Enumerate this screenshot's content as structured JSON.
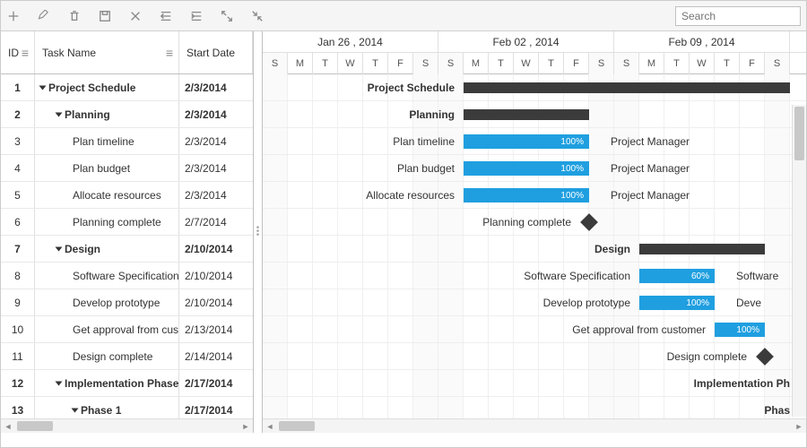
{
  "toolbar": {
    "search_placeholder": "Search",
    "icons": [
      "plus",
      "edit",
      "trash",
      "save",
      "cancel",
      "outdent",
      "indent",
      "expand",
      "collapse"
    ]
  },
  "grid": {
    "headers": {
      "id": "ID",
      "task": "Task Name",
      "date": "Start Date"
    },
    "rows": [
      {
        "id": "1",
        "name": "Project Schedule",
        "date": "2/3/2014",
        "indent": 0,
        "bold": true,
        "expander": true
      },
      {
        "id": "2",
        "name": "Planning",
        "date": "2/3/2014",
        "indent": 1,
        "bold": true,
        "expander": true
      },
      {
        "id": "3",
        "name": "Plan timeline",
        "date": "2/3/2014",
        "indent": 2
      },
      {
        "id": "4",
        "name": "Plan budget",
        "date": "2/3/2014",
        "indent": 2
      },
      {
        "id": "5",
        "name": "Allocate resources",
        "date": "2/3/2014",
        "indent": 2
      },
      {
        "id": "6",
        "name": "Planning complete",
        "date": "2/7/2014",
        "indent": 2
      },
      {
        "id": "7",
        "name": "Design",
        "date": "2/10/2014",
        "indent": 1,
        "bold": true,
        "expander": true
      },
      {
        "id": "8",
        "name": "Software Specification",
        "date": "2/10/2014",
        "indent": 2
      },
      {
        "id": "9",
        "name": "Develop prototype",
        "date": "2/10/2014",
        "indent": 2
      },
      {
        "id": "10",
        "name": "Get approval from customer",
        "date": "2/13/2014",
        "indent": 2
      },
      {
        "id": "11",
        "name": "Design complete",
        "date": "2/14/2014",
        "indent": 2
      },
      {
        "id": "12",
        "name": "Implementation Phase",
        "date": "2/17/2014",
        "indent": 1,
        "bold": true,
        "expander": true
      },
      {
        "id": "13",
        "name": "Phase 1",
        "date": "2/17/2014",
        "indent": 2,
        "bold": true,
        "expander": true
      }
    ]
  },
  "timeline": {
    "day_width": 28,
    "start_day_index": 0,
    "weeks": [
      {
        "label": "Jan 26 , 2014",
        "days": 7
      },
      {
        "label": "Feb 02 , 2014",
        "days": 7
      },
      {
        "label": "Feb 09 , 2014",
        "days": 7
      }
    ],
    "day_letters": [
      "S",
      "M",
      "T",
      "W",
      "T",
      "F",
      "S"
    ],
    "rows": [
      {
        "type": "summary",
        "label": "Project Schedule",
        "label_side": "left",
        "start": 8,
        "end": 21
      },
      {
        "type": "summary",
        "label": "Planning",
        "label_side": "left",
        "start": 8,
        "end": 13
      },
      {
        "type": "task",
        "label": "Plan timeline",
        "label_side": "left",
        "start": 8,
        "end": 13,
        "progress": 100,
        "resource": "Project Manager"
      },
      {
        "type": "task",
        "label": "Plan budget",
        "label_side": "left",
        "start": 8,
        "end": 13,
        "progress": 100,
        "resource": "Project Manager"
      },
      {
        "type": "task",
        "label": "Allocate resources",
        "label_side": "left",
        "start": 8,
        "end": 13,
        "progress": 100,
        "resource": "Project Manager"
      },
      {
        "type": "milestone",
        "label": "Planning complete",
        "label_side": "left",
        "start": 13
      },
      {
        "type": "summary",
        "label": "Design",
        "label_side": "left",
        "start": 15,
        "end": 20
      },
      {
        "type": "task",
        "label": "Software Specification",
        "label_side": "left",
        "start": 15,
        "end": 18,
        "progress": 60,
        "resource": "Software"
      },
      {
        "type": "task",
        "label": "Develop prototype",
        "label_side": "left",
        "start": 15,
        "end": 18,
        "progress": 100,
        "resource": "Deve"
      },
      {
        "type": "task",
        "label": "Get approval from customer",
        "label_side": "left",
        "start": 18,
        "end": 20,
        "progress": 100
      },
      {
        "type": "milestone",
        "label": "Design complete",
        "label_side": "left",
        "start": 20
      },
      {
        "type": "label",
        "label": "Implementation Ph",
        "label_side": "right-edge"
      },
      {
        "type": "label",
        "label": "Phas",
        "label_side": "right-edge"
      }
    ]
  },
  "chart_data": {
    "type": "gantt",
    "time_axis": {
      "start": "2014-01-26",
      "unit": "day",
      "visible_days": 21
    },
    "tasks": [
      {
        "id": 1,
        "name": "Project Schedule",
        "start": "2014-02-03",
        "type": "summary"
      },
      {
        "id": 2,
        "name": "Planning",
        "start": "2014-02-03",
        "end": "2014-02-07",
        "type": "summary"
      },
      {
        "id": 3,
        "name": "Plan timeline",
        "start": "2014-02-03",
        "end": "2014-02-07",
        "progress": 100,
        "resource": "Project Manager"
      },
      {
        "id": 4,
        "name": "Plan budget",
        "start": "2014-02-03",
        "end": "2014-02-07",
        "progress": 100,
        "resource": "Project Manager"
      },
      {
        "id": 5,
        "name": "Allocate resources",
        "start": "2014-02-03",
        "end": "2014-02-07",
        "progress": 100,
        "resource": "Project Manager"
      },
      {
        "id": 6,
        "name": "Planning complete",
        "start": "2014-02-07",
        "type": "milestone"
      },
      {
        "id": 7,
        "name": "Design",
        "start": "2014-02-10",
        "end": "2014-02-14",
        "type": "summary"
      },
      {
        "id": 8,
        "name": "Software Specification",
        "start": "2014-02-10",
        "end": "2014-02-12",
        "progress": 60
      },
      {
        "id": 9,
        "name": "Develop prototype",
        "start": "2014-02-10",
        "end": "2014-02-12",
        "progress": 100
      },
      {
        "id": 10,
        "name": "Get approval from customer",
        "start": "2014-02-13",
        "end": "2014-02-14",
        "progress": 100
      },
      {
        "id": 11,
        "name": "Design complete",
        "start": "2014-02-14",
        "type": "milestone"
      },
      {
        "id": 12,
        "name": "Implementation Phase",
        "start": "2014-02-17",
        "type": "summary"
      },
      {
        "id": 13,
        "name": "Phase 1",
        "start": "2014-02-17",
        "type": "summary"
      }
    ]
  }
}
